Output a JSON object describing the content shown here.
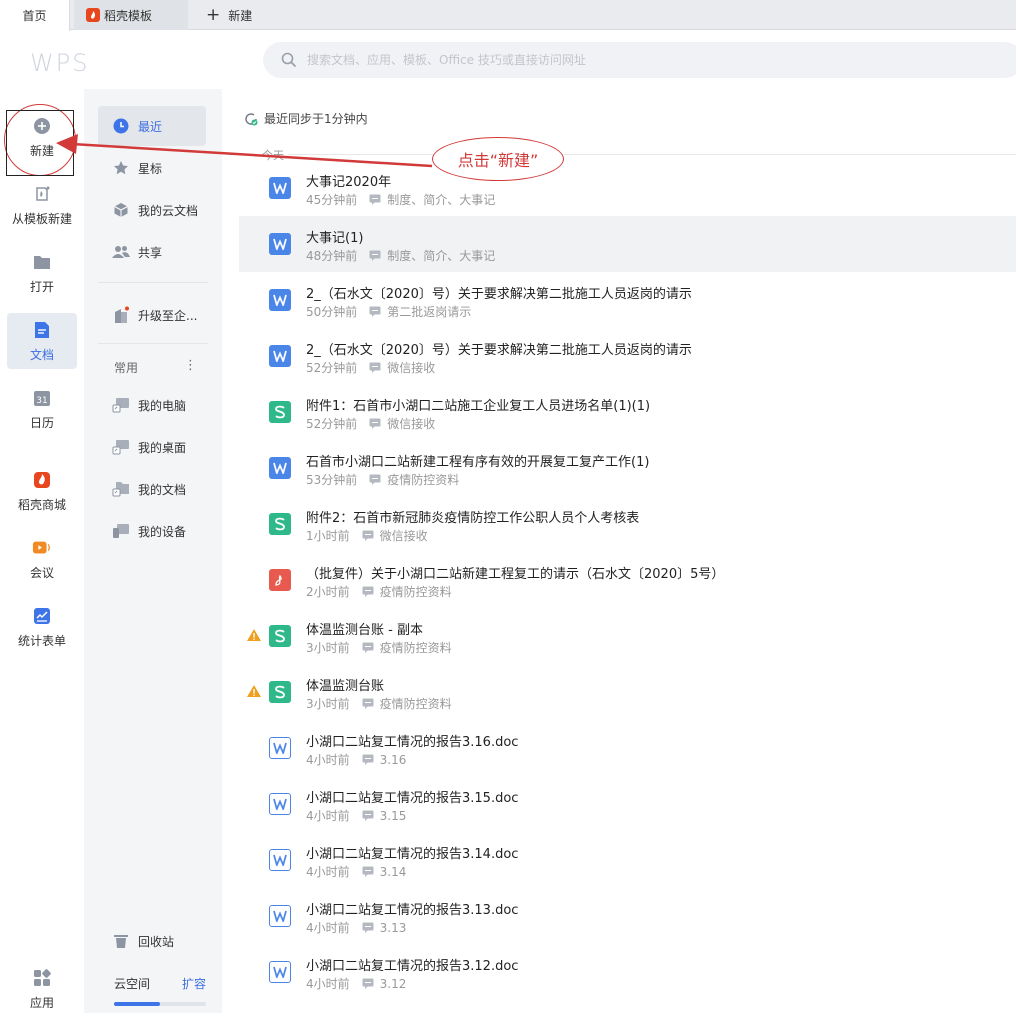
{
  "tabs": {
    "home": "首页",
    "template": "稻壳模板",
    "new_tab": "新建"
  },
  "header": {
    "logo": "WPS",
    "search_placeholder": "搜索文档、应用、模板、Office 技巧或直接访问网址"
  },
  "leftnav": {
    "new": "新建",
    "from_template": "从模板新建",
    "open": "打开",
    "docs": "文档",
    "calendar": "日历",
    "calendar_number": "31",
    "store": "稻壳商城",
    "meeting": "会议",
    "form": "统计表单",
    "apps": "应用"
  },
  "sidebar": {
    "recent": "最近",
    "starred": "星标",
    "cloud_docs": "我的云文档",
    "shared": "共享",
    "upgrade": "升级至企...",
    "frequent_label": "常用",
    "frequent_more": "⋮",
    "my_computer": "我的电脑",
    "my_desktop": "我的桌面",
    "my_documents": "我的文档",
    "my_devices": "我的设备",
    "recycle_bin": "回收站",
    "cloud_space": "云空间",
    "expand": "扩容",
    "cloud_usage_fraction": 0.5
  },
  "main": {
    "sync_status": "最近同步于1分钟内",
    "today": "今天",
    "files": [
      {
        "type": "w",
        "name": "大事记2020年",
        "time": "45分钟前",
        "tag": "制度、简介、大事记"
      },
      {
        "type": "w",
        "name": "大事记(1)",
        "time": "48分钟前",
        "tag": "制度、简介、大事记"
      },
      {
        "type": "w",
        "name": "2_（石水文〔2020〕号）关于要求解决第二批施工人员返岗的请示",
        "time": "50分钟前",
        "tag": "第二批返岗请示"
      },
      {
        "type": "w",
        "name": "2_（石水文〔2020〕号）关于要求解决第二批施工人员返岗的请示",
        "time": "52分钟前",
        "tag": "微信接收"
      },
      {
        "type": "s",
        "name": "附件1：石首市小湖口二站施工企业复工人员进场名单(1)(1)",
        "time": "52分钟前",
        "tag": "微信接收"
      },
      {
        "type": "w",
        "name": "石首市小湖口二站新建工程有序有效的开展复工复产工作(1)",
        "time": "53分钟前",
        "tag": "疫情防控资料"
      },
      {
        "type": "s",
        "name": "附件2：石首市新冠肺炎疫情防控工作公职人员个人考核表",
        "time": "1小时前",
        "tag": "微信接收"
      },
      {
        "type": "p",
        "name": "（批复件）关于小湖口二站新建工程复工的请示（石水文〔2020〕5号）",
        "time": "2小时前",
        "tag": "疫情防控资料"
      },
      {
        "type": "s",
        "name": "体温监测台账 - 副本",
        "time": "3小时前",
        "tag": "疫情防控资料",
        "warn": true
      },
      {
        "type": "s",
        "name": "体温监测台账",
        "time": "3小时前",
        "tag": "疫情防控资料",
        "warn": true
      },
      {
        "type": "wo",
        "name": "小湖口二站复工情况的报告3.16.doc",
        "time": "4小时前",
        "tag": "3.16"
      },
      {
        "type": "wo",
        "name": "小湖口二站复工情况的报告3.15.doc",
        "time": "4小时前",
        "tag": "3.15"
      },
      {
        "type": "wo",
        "name": "小湖口二站复工情况的报告3.14.doc",
        "time": "4小时前",
        "tag": "3.14"
      },
      {
        "type": "wo",
        "name": "小湖口二站复工情况的报告3.13.doc",
        "time": "4小时前",
        "tag": "3.13"
      },
      {
        "type": "wo",
        "name": "小湖口二站复工情况的报告3.12.doc",
        "time": "4小时前",
        "tag": "3.12"
      }
    ],
    "selected_index": 1
  },
  "annotation": {
    "callout": "点击“新建”"
  },
  "colors": {
    "accent": "#3d6ee0",
    "annotation": "#d23a3a",
    "word": "#4a86e8",
    "sheet": "#2fb889",
    "pdf": "#e85a4f"
  }
}
